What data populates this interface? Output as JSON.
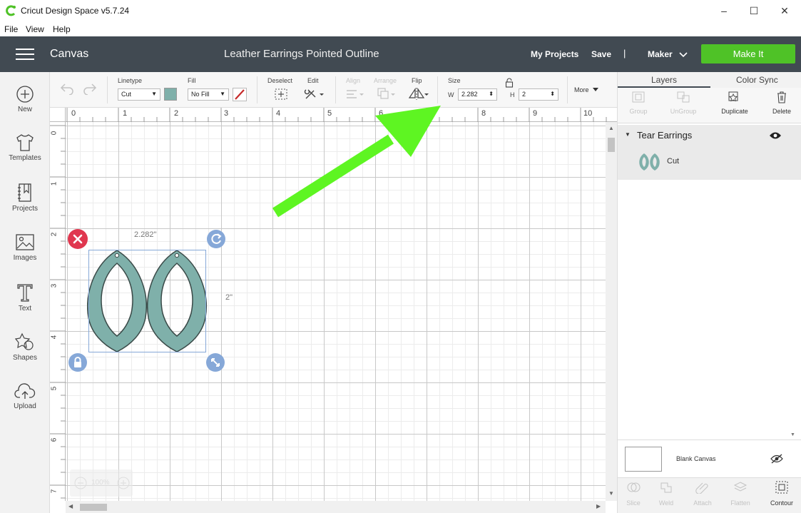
{
  "window": {
    "title": "Cricut Design Space  v5.7.24",
    "minimize": "–",
    "maximize": "☐",
    "close": "✕"
  },
  "menu": [
    "File",
    "View",
    "Help"
  ],
  "header": {
    "section": "Canvas",
    "project_title": "Leather Earrings Pointed Outline",
    "my_projects": "My Projects",
    "save": "Save",
    "separator": "|",
    "machine": "Maker",
    "make_it": "Make It"
  },
  "sidebar": [
    {
      "label": "New",
      "icon": "plus-circle-icon"
    },
    {
      "label": "Templates",
      "icon": "tshirt-icon"
    },
    {
      "label": "Projects",
      "icon": "notebook-icon"
    },
    {
      "label": "Images",
      "icon": "image-icon"
    },
    {
      "label": "Text",
      "icon": "text-icon"
    },
    {
      "label": "Shapes",
      "icon": "shapes-icon"
    },
    {
      "label": "Upload",
      "icon": "cloud-upload-icon"
    }
  ],
  "toolbar": {
    "linetype_label": "Linetype",
    "linetype_value": "Cut",
    "linetype_color": "#7fb0aa",
    "fill_label": "Fill",
    "fill_value": "No Fill",
    "deselect_label": "Deselect",
    "edit_label": "Edit",
    "align_label": "Align",
    "arrange_label": "Arrange",
    "flip_label": "Flip",
    "size_label": "Size",
    "w_label": "W",
    "w_value": "2.282",
    "h_label": "H",
    "h_value": "2",
    "more_label": "More"
  },
  "ruler": {
    "top": [
      "0",
      "1",
      "2",
      "3",
      "4",
      "5",
      "6",
      "7",
      "8",
      "9",
      "10"
    ],
    "left": [
      "0",
      "1",
      "2",
      "3",
      "4",
      "5",
      "6",
      "7"
    ]
  },
  "selection": {
    "width_label": "2.282\"",
    "height_label": "2\"",
    "shape_fill": "#7fb0aa"
  },
  "zoom": "100%",
  "panel": {
    "tabs": [
      "Layers",
      "Color Sync"
    ],
    "tools": [
      "Group",
      "UnGroup",
      "Duplicate",
      "Delete"
    ],
    "group_name": "Tear Earrings",
    "layer_name": "Cut",
    "blank_canvas": "Blank Canvas",
    "bottom_tools": [
      "Slice",
      "Weld",
      "Attach",
      "Flatten",
      "Contour"
    ]
  },
  "colors": {
    "header_bg": "#414a52",
    "make_it": "#4fc227",
    "arrow": "#5ef522",
    "delete_handle": "#e0374f",
    "handle_blue": "#86a8d8"
  }
}
